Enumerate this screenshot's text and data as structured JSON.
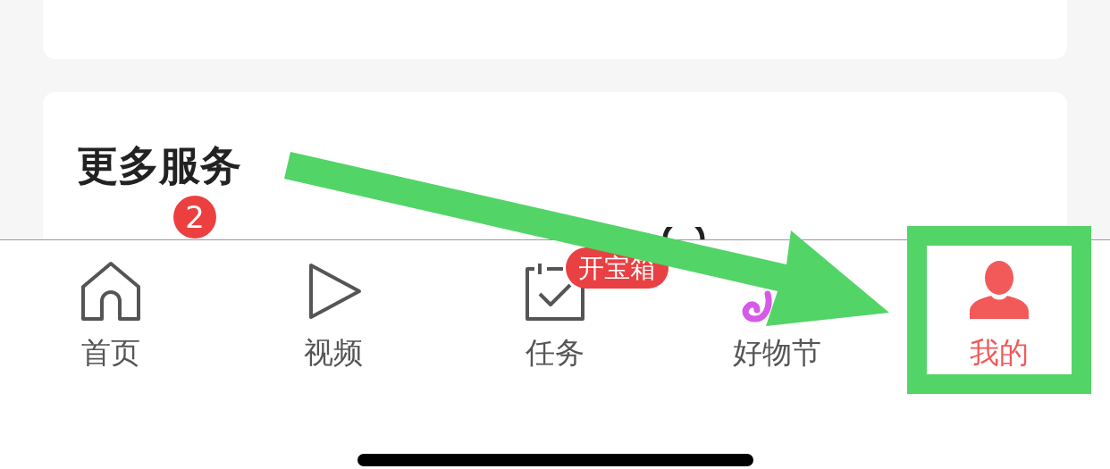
{
  "section": {
    "title": "更多服务",
    "badge": "2"
  },
  "tabs": [
    {
      "label": "首页",
      "kind": "home",
      "selected": false
    },
    {
      "label": "视频",
      "kind": "video",
      "selected": false
    },
    {
      "label": "任务",
      "kind": "task",
      "selected": false,
      "badge": "开宝箱"
    },
    {
      "label": "好物节",
      "kind": "festival",
      "selected": false
    },
    {
      "label": "我的",
      "kind": "profile",
      "selected": true
    }
  ]
}
